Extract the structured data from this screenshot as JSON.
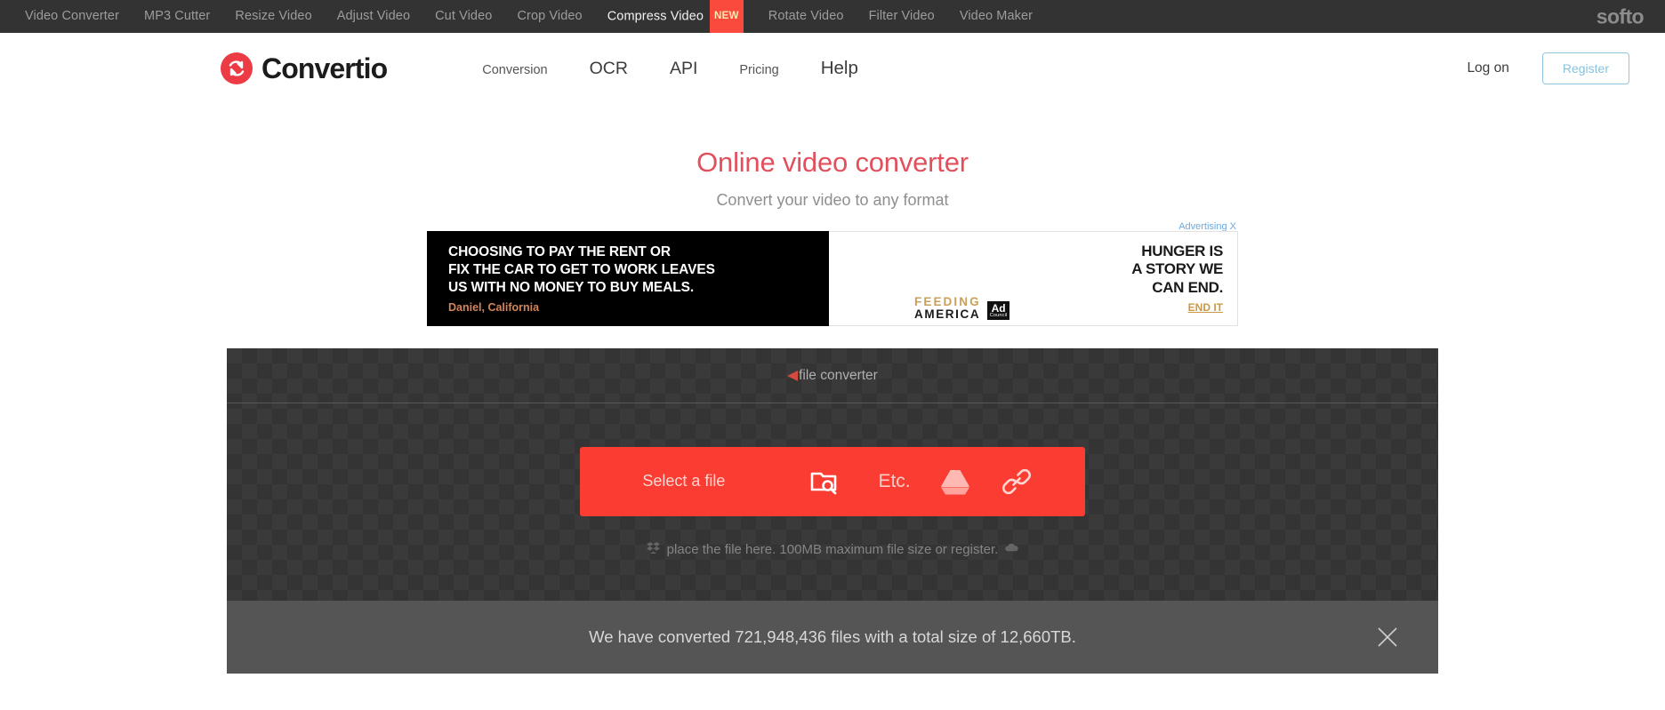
{
  "topbar": {
    "links": [
      {
        "label": "Video Converter",
        "active": false
      },
      {
        "label": "MP3 Cutter",
        "active": false
      },
      {
        "label": "Resize Video",
        "active": false
      },
      {
        "label": "Adjust Video",
        "active": false
      },
      {
        "label": "Cut Video",
        "active": false
      },
      {
        "label": "Crop Video",
        "active": false
      },
      {
        "label": "Compress Video",
        "active": true,
        "badge": "NEW"
      },
      {
        "label": "Rotate Video",
        "active": false
      },
      {
        "label": "Filter Video",
        "active": false
      },
      {
        "label": "Video Maker",
        "active": false
      }
    ],
    "brand": "softo"
  },
  "header": {
    "logo_text": "Convertio",
    "logo_icon": "convertio-circular-arrows-icon",
    "nav": [
      {
        "label": "Conversion",
        "size": "sm"
      },
      {
        "label": "OCR",
        "size": "lg"
      },
      {
        "label": "API",
        "size": "lg"
      },
      {
        "label": "Pricing",
        "size": "sm"
      },
      {
        "label": "Help",
        "size": "xl"
      }
    ],
    "log_on": "Log on",
    "register": "Register"
  },
  "hero": {
    "title": "Online video converter",
    "subtitle": "Convert your video to any format"
  },
  "ad": {
    "label": "Advertising X",
    "left": {
      "headline": [
        "CHOOSING TO PAY THE RENT OR",
        "FIX THE CAR TO GET TO WORK LEAVES",
        "US WITH NO MONEY TO BUY MEALS."
      ],
      "attribution": "Daniel, California"
    },
    "right": {
      "headline": [
        "HUNGER IS",
        "A STORY WE",
        "CAN END."
      ],
      "cta": "END IT",
      "sponsor_line1": "FEEDING",
      "sponsor_line2": "AMERICA",
      "adcouncil_top": "Ad",
      "adcouncil_bottom": "Council"
    }
  },
  "dropzone": {
    "converter_arrow": "◀",
    "converter_link": "file converter",
    "select_label": "Select a file",
    "etc_label": "Etc.",
    "icons": {
      "folder": "folder-search-icon",
      "drive": "google-drive-icon",
      "link": "url-link-icon",
      "dropbox": "dropbox-icon",
      "onedrive": "onedrive-icon"
    },
    "hint": "place the file here. 100MB maximum file size or register."
  },
  "status": {
    "text": "We have converted 721,948,436 files with a total size of 12,660TB.",
    "close_icon": "close-icon"
  },
  "colors": {
    "accent_red": "#fa3c32",
    "title_red": "#e2505d",
    "topbar_bg": "#333334",
    "dropzone_bg": "#3a3a3a",
    "status_bg": "#555556",
    "register_border": "#8fc7e0"
  }
}
